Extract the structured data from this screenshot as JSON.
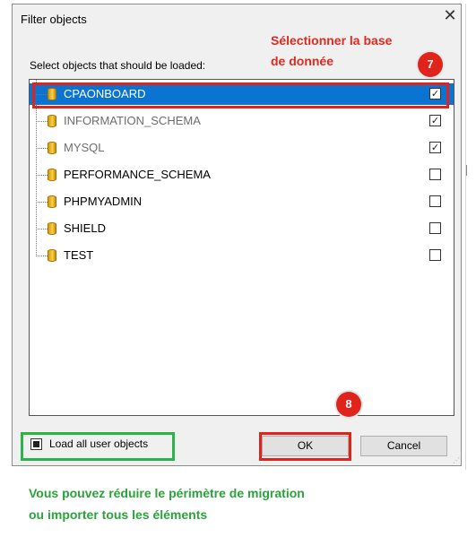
{
  "dialog": {
    "title": "Filter objects",
    "close_symbol": "✕",
    "prompt": "Select objects that should be loaded:"
  },
  "tree": {
    "items": [
      {
        "label": "CPAONBOARD",
        "checked": true,
        "selected": true
      },
      {
        "label": "INFORMATION_SCHEMA",
        "checked": true,
        "selected": false
      },
      {
        "label": "MYSQL",
        "checked": true,
        "selected": false
      },
      {
        "label": "PERFORMANCE_SCHEMA",
        "checked": false,
        "selected": false
      },
      {
        "label": "PHPMYADMIN",
        "checked": false,
        "selected": false
      },
      {
        "label": "SHIELD",
        "checked": false,
        "selected": false
      },
      {
        "label": "TEST",
        "checked": false,
        "selected": false
      }
    ],
    "check_mark": "✓",
    "icon": "database-icon"
  },
  "footer": {
    "load_all_label": "Load all user objects",
    "ok_label": "OK",
    "cancel_label": "Cancel"
  },
  "annotations": {
    "red_line1": "Sélectionner la base",
    "red_line2": "de donnée",
    "badge_7": "7",
    "badge_8": "8",
    "green_line1": "Vous pouvez réduire le périmètre de migration",
    "green_line2": "ou importer tous les éléments"
  },
  "colors": {
    "selection": "#0b73d2",
    "annotation_red": "#e0231b",
    "annotation_green": "#2cb34a",
    "dialog_bg": "#f0f0f0"
  }
}
